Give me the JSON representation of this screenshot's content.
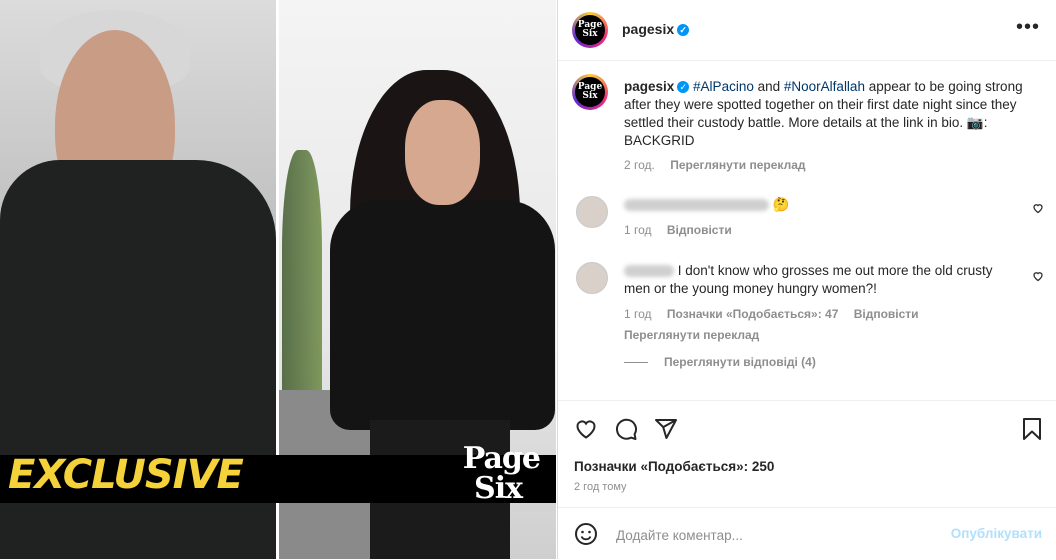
{
  "post": {
    "username": "pagesix",
    "avatar_text": "Page Six",
    "photo": {
      "exclusive_label": "EXCLUSIVE",
      "watermark_line1": "Page",
      "watermark_line2": "Six"
    }
  },
  "caption": {
    "username": "pagesix",
    "hashtag1": "#AlPacino",
    "word_and": "and",
    "hashtag2": "#NoorAlfallah",
    "text": "appear to be going strong after they were spotted together on their first date night since they settled their custody battle. More details at the link in bio. 📷: BACKGRID",
    "time": "2 год.",
    "translate": "Переглянути переклад"
  },
  "comments": [
    {
      "emoji": "🤔",
      "time": "1 год",
      "reply": "Відповісти"
    },
    {
      "text": "I don't know who grosses me out more the old crusty men or the young money hungry women?!",
      "time": "1 год",
      "likes": "Позначки «Подобається»: 47",
      "reply": "Відповісти",
      "translate": "Переглянути переклад"
    }
  ],
  "view_replies": "Переглянути відповіді (4)",
  "actions": {
    "likes_label": "Позначки «Подобається»: 250",
    "time": "2 год тому"
  },
  "add_comment": {
    "placeholder": "Додайте коментар...",
    "post_label": "Опублікувати"
  },
  "icons": {
    "like": "heart-icon",
    "comment": "comment-icon",
    "share": "share-icon",
    "save": "bookmark-icon",
    "more": "more-icon",
    "emoji": "emoji-icon",
    "verified": "verified-badge-icon"
  },
  "colors": {
    "link": "#00376b",
    "verified": "#0095f6",
    "exclusive": "#f5d13a"
  }
}
